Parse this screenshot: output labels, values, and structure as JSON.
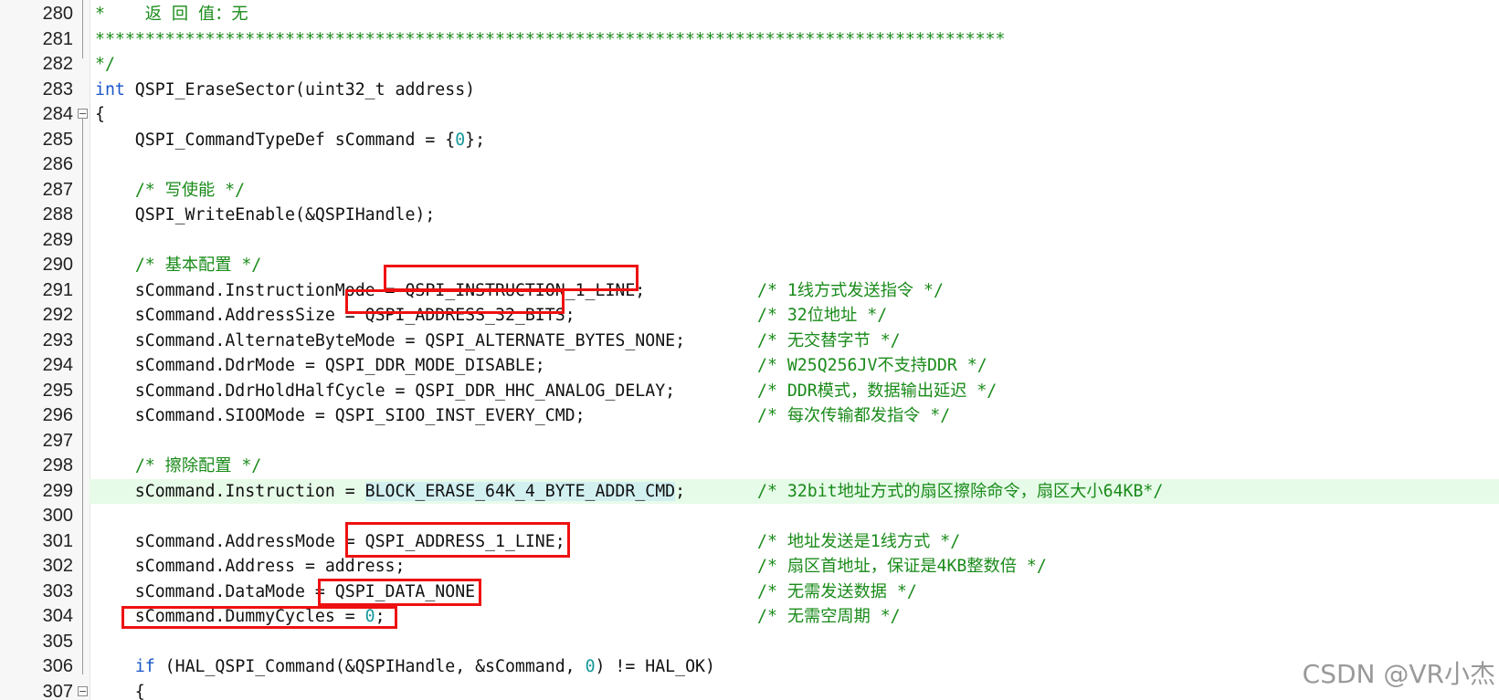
{
  "editor": {
    "lines": [
      {
        "num": "280",
        "segs": [
          {
            "t": "*    返 回 值：无",
            "c": "cm"
          }
        ]
      },
      {
        "num": "281",
        "segs": [
          {
            "t": "*******************************************************************************************",
            "c": "cm"
          }
        ]
      },
      {
        "num": "282",
        "segs": [
          {
            "t": "*/",
            "c": "cm"
          }
        ]
      },
      {
        "num": "283",
        "segs": [
          {
            "t": "int",
            "c": "kw"
          },
          {
            "t": " QSPI_EraseSector(uint32_t address)"
          }
        ]
      },
      {
        "num": "284",
        "segs": [
          {
            "t": "{"
          }
        ]
      },
      {
        "num": "285",
        "segs": [
          {
            "t": "    QSPI_CommandTypeDef sCommand = {"
          },
          {
            "t": "0",
            "c": "num"
          },
          {
            "t": "};"
          }
        ]
      },
      {
        "num": "286",
        "segs": []
      },
      {
        "num": "287",
        "segs": [
          {
            "t": "    "
          },
          {
            "t": "/* 写使能 */",
            "c": "cm"
          }
        ]
      },
      {
        "num": "288",
        "segs": [
          {
            "t": "    QSPI_WriteEnable(&QSPIHandle);"
          }
        ]
      },
      {
        "num": "289",
        "segs": []
      },
      {
        "num": "290",
        "segs": [
          {
            "t": "    "
          },
          {
            "t": "/* 基本配置 */",
            "c": "cm"
          }
        ]
      },
      {
        "num": "291",
        "segs": [
          {
            "t": "    sCommand.InstructionMode = QSPI_INSTRUCTION_1_LINE;"
          }
        ],
        "comment": "/* 1线方式发送指令 */"
      },
      {
        "num": "292",
        "segs": [
          {
            "t": "    sCommand.AddressSize = QSPI_ADDRESS_32_BITS;"
          }
        ],
        "comment": "/* 32位地址 */"
      },
      {
        "num": "293",
        "segs": [
          {
            "t": "    sCommand.AlternateByteMode = QSPI_ALTERNATE_BYTES_NONE;"
          }
        ],
        "comment": "/* 无交替字节 */"
      },
      {
        "num": "294",
        "segs": [
          {
            "t": "    sCommand.DdrMode = QSPI_DDR_MODE_DISABLE;"
          }
        ],
        "comment": "/* W25Q256JV不支持DDR */"
      },
      {
        "num": "295",
        "segs": [
          {
            "t": "    sCommand.DdrHoldHalfCycle = QSPI_DDR_HHC_ANALOG_DELAY;"
          }
        ],
        "comment": "/* DDR模式，数据输出延迟 */"
      },
      {
        "num": "296",
        "segs": [
          {
            "t": "    sCommand.SIOOMode = QSPI_SIOO_INST_EVERY_CMD;"
          }
        ],
        "comment": "/* 每次传输都发指令 */"
      },
      {
        "num": "297",
        "segs": []
      },
      {
        "num": "298",
        "segs": [
          {
            "t": "    "
          },
          {
            "t": "/* 擦除配置 */",
            "c": "cm"
          }
        ]
      },
      {
        "num": "299",
        "segs": [
          {
            "t": "    sCommand.Instruction = "
          },
          {
            "t": "BLOCK_ERASE_64K_4_BYTE_ADDR_CMD",
            "c": "sel"
          },
          {
            "t": ";"
          }
        ],
        "comment": "/* 32bit地址方式的扇区擦除命令，扇区大小64KB*/",
        "highlight": true
      },
      {
        "num": "300",
        "segs": []
      },
      {
        "num": "301",
        "segs": [
          {
            "t": "    sCommand.AddressMode = QSPI_ADDRESS_1_LINE;"
          }
        ],
        "comment": "/* 地址发送是1线方式 */"
      },
      {
        "num": "302",
        "segs": [
          {
            "t": "    sCommand.Address = address;"
          }
        ],
        "comment": "/* 扇区首地址，保证是4KB整数倍 */"
      },
      {
        "num": "303",
        "segs": [
          {
            "t": "    sCommand.DataMode = QSPI_DATA_NONE;"
          }
        ],
        "comment": "/* 无需发送数据 */"
      },
      {
        "num": "304",
        "segs": [
          {
            "t": "    sCommand.DummyCycles = "
          },
          {
            "t": "0",
            "c": "num"
          },
          {
            "t": ";"
          }
        ],
        "comment": "/* 无需空周期 */"
      },
      {
        "num": "305",
        "segs": []
      },
      {
        "num": "306",
        "segs": [
          {
            "t": "    "
          },
          {
            "t": "if",
            "c": "kw"
          },
          {
            "t": " (HAL_QSPI_Command(&QSPIHandle, &sCommand, "
          },
          {
            "t": "0",
            "c": "num"
          },
          {
            "t": ") != HAL_OK)"
          }
        ]
      },
      {
        "num": "307",
        "segs": [
          {
            "t": "    {"
          }
        ]
      }
    ]
  },
  "watermark": "CSDN @VR小杰",
  "colors": {
    "keyword": "#1a56c9",
    "comment": "#1a8b1a",
    "number": "#16989a",
    "highlight_line": "#e7fbe9",
    "annotation_box": "#ee1111"
  }
}
